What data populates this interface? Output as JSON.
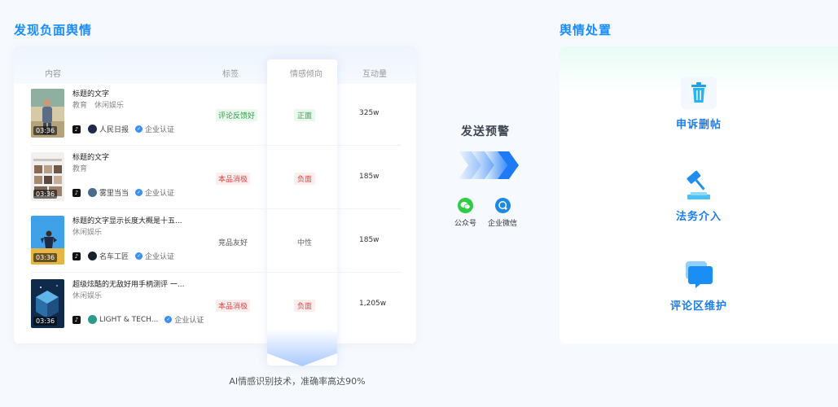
{
  "left_section": {
    "title": "发现负面舆情"
  },
  "right_section": {
    "title": "舆情处置"
  },
  "table": {
    "headers": [
      "内容",
      "标签",
      "情感倾向",
      "互动量"
    ],
    "rows": [
      {
        "title": "标题的文字",
        "categories": [
          "教育",
          "休闲娱乐"
        ],
        "duration": "03:36",
        "author": "人民日报",
        "verify": "企业认证",
        "tag": "评论反馈好",
        "tag_type": "green",
        "sentiment": "正面",
        "sentiment_type": "green",
        "interactions": "325w",
        "thumb": "person"
      },
      {
        "title": "标题的文字",
        "categories": [
          "教育"
        ],
        "duration": "03:36",
        "author": "雾里当当",
        "verify": "企业认证",
        "tag": "本品消极",
        "tag_type": "red",
        "sentiment": "负面",
        "sentiment_type": "red",
        "interactions": "185w",
        "thumb": "grid"
      },
      {
        "title": "标题的文字显示长度大概是十五...",
        "categories": [
          "休闲娱乐"
        ],
        "duration": "03:36",
        "author": "名车工匠",
        "verify": "企业认证",
        "tag": "竞品友好",
        "tag_type": "plain",
        "sentiment": "中性",
        "sentiment_type": "gray",
        "interactions": "185w",
        "thumb": "sky"
      },
      {
        "title": "超级炫酷的无敌好用手柄测评 一...",
        "categories": [
          "休闲娱乐"
        ],
        "duration": "03:36",
        "author": "LIGHT & TECH...",
        "verify": "企业认证",
        "tag": "本品消极",
        "tag_type": "red",
        "sentiment": "负面",
        "sentiment_type": "red",
        "interactions": "1,205w",
        "thumb": "cube"
      }
    ]
  },
  "ai_note": "AI情感识别技术，准确率高达90%",
  "alert": {
    "title": "发送预警",
    "channels": [
      {
        "label": "公众号",
        "icon": "wechat-icon",
        "color": "#2ecc40"
      },
      {
        "label": "企业微信",
        "icon": "wecom-icon",
        "color": "#1e88e5"
      }
    ]
  },
  "actions": [
    {
      "label": "申诉删帖",
      "icon": "trash-icon"
    },
    {
      "label": "法务介入",
      "icon": "gavel-icon"
    },
    {
      "label": "评论区维护",
      "icon": "comment-icon"
    }
  ],
  "colors": {
    "accent": "#1a8cff",
    "positive": "#2fa24a",
    "negative": "#e04545"
  }
}
